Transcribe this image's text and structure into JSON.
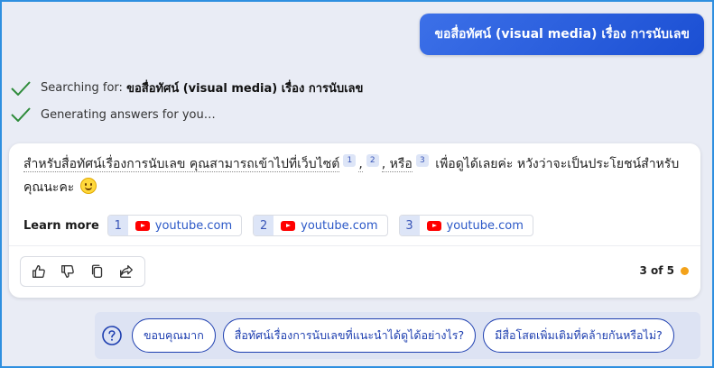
{
  "user_message": "ขอสื่อทัศน์ (visual media) เรื่อง การนับเลข",
  "status": {
    "searching_prefix": "Searching for: ",
    "searching_query": "ขอสื่อทัศน์ (visual media) เรื่อง การนับเลข",
    "generating": "Generating answers for you…"
  },
  "answer": {
    "part1": "สำหรับสื่อทัศน์เรื่องการนับเลข คุณสามารถเข้าไปที่เว็บไซต์",
    "cite1": "1",
    "sep1": ",",
    "cite2": "2",
    "sep2": ", หรือ",
    "cite3": "3",
    "part2": " เพื่อดูได้เลยค่ะ หวังว่าจะเป็นประโยชน์สำหรับคุณนะคะ "
  },
  "learn_more": {
    "label": "Learn more",
    "sources": [
      {
        "num": "1",
        "site": "youtube.com"
      },
      {
        "num": "2",
        "site": "youtube.com"
      },
      {
        "num": "3",
        "site": "youtube.com"
      }
    ]
  },
  "pagination": "3 of 5",
  "colors": {
    "accent": "#1b4fd3",
    "status_dot": "#f3a21a",
    "check": "#2e8b3a"
  },
  "icons": [
    "check-icon",
    "thumbs-up-icon",
    "thumbs-down-icon",
    "copy-icon",
    "share-icon",
    "help-icon",
    "youtube-icon"
  ],
  "suggestions": [
    "ขอบคุณมาก",
    "สื่อทัศน์เรื่องการนับเลขที่แนะนำได้ดูได้อย่างไร?",
    "มีสื่อโสตเพิ่มเติมที่คล้ายกันหรือไม่?"
  ]
}
